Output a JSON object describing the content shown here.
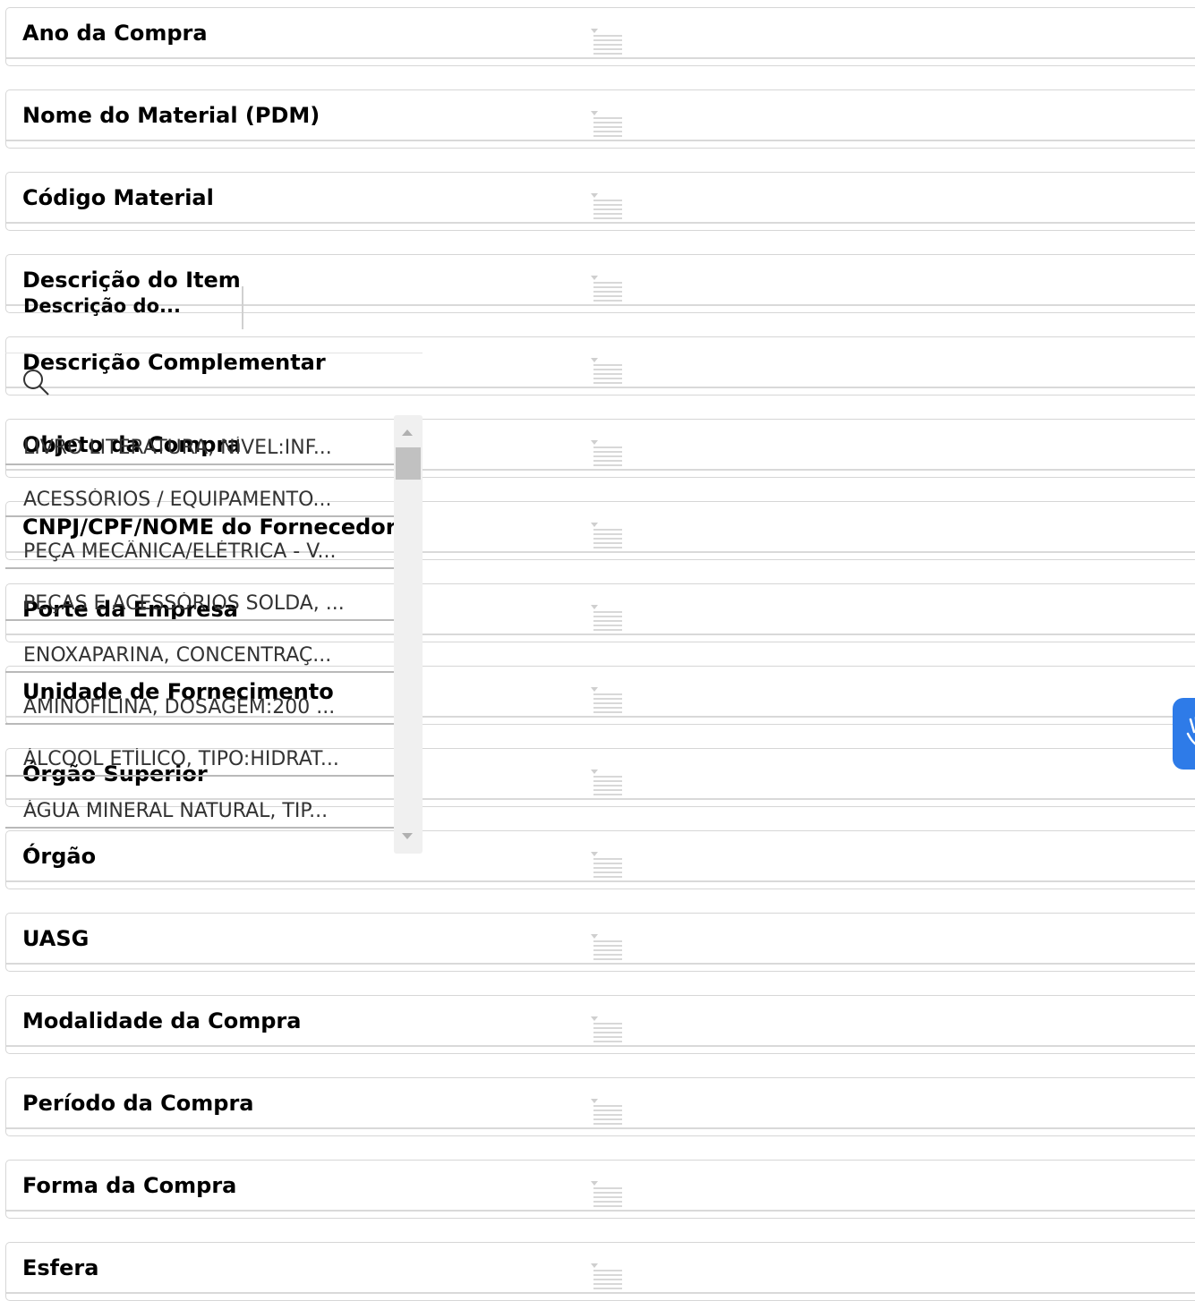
{
  "filters": [
    {
      "title": "Ano da Compra",
      "icon": "filter-list-icon"
    },
    {
      "title": "Nome do Material (PDM)",
      "icon": "filter-list-icon"
    },
    {
      "title": "Código Material",
      "icon": "filter-list-icon"
    },
    {
      "title": "Descrição do Item",
      "icon": "filter-list-icon"
    },
    {
      "title": "Descrição Complementar",
      "icon": "filter-list-icon"
    },
    {
      "title": "Objeto da Compra",
      "icon": "filter-list-icon"
    },
    {
      "title": "CNPJ/CPF/NOME do Fornecedor",
      "icon": "filter-list-icon"
    },
    {
      "title": "Porte da Empresa",
      "icon": "filter-list-icon"
    },
    {
      "title": "Unidade de Fornecimento",
      "icon": "filter-list-icon"
    },
    {
      "title": "Órgão Superior",
      "icon": "filter-list-icon"
    },
    {
      "title": "Órgão",
      "icon": "filter-list-icon"
    },
    {
      "title": "UASG",
      "icon": "filter-list-icon"
    },
    {
      "title": "Modalidade da Compra",
      "icon": "filter-list-icon"
    },
    {
      "title": "Período da Compra",
      "icon": "filter-list-icon"
    },
    {
      "title": "Forma da Compra",
      "icon": "filter-list-icon"
    },
    {
      "title": "Esfera",
      "icon": "filter-list-icon"
    }
  ],
  "dropdown": {
    "header_label": "Descrição do...",
    "search_icon": "search-icon",
    "items": [
      "LIVRO LITERATURA, NÍVEL:INF...",
      "ACESSÓRIOS / EQUIPAMENTO...",
      "PEÇA MECÂNICA/ELÉTRICA - V...",
      "PEÇAS E ACESSÓRIOS SOLDA, ...",
      "ENOXAPARINA, CONCENTRAÇ...",
      "AMINOFILINA, DOSAGEM:200 ...",
      "ÁLCOOL ETÍLICO, TIPO:HIDRAT...",
      "ÁGUA MINERAL NATURAL, TIP...",
      "ÁGUA MINERAL NATURAL, TIP..."
    ]
  },
  "side_tab": {
    "icon": "accessibility-hand-icon",
    "color": "#2e7be8"
  }
}
